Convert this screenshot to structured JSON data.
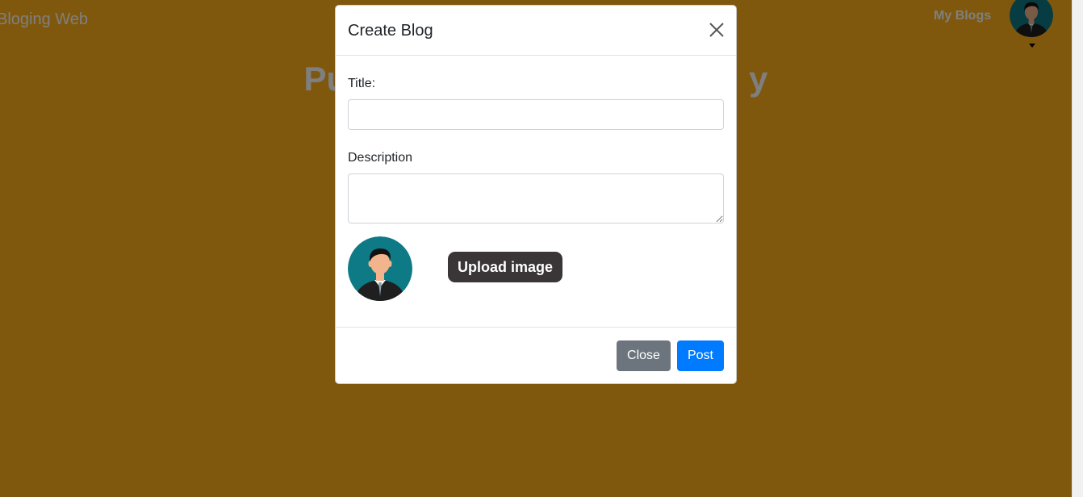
{
  "navbar": {
    "brand": "Bloging Web",
    "my_blogs": "My Blogs",
    "avatar_icon": "user-avatar-icon",
    "caret_icon": "caret-down-icon"
  },
  "hero": {
    "title_left": "Pu",
    "title_right": "y"
  },
  "modal": {
    "title": "Create Blog",
    "close_icon": "close-icon",
    "title_label": "Title:",
    "title_value": "",
    "description_label": "Description",
    "description_value": "",
    "upload_label": "Upload image",
    "image_icon": "user-avatar-icon",
    "close_button": "Close",
    "post_button": "Post"
  },
  "colors": {
    "page_background": "#ffb01a",
    "primary": "#007bff",
    "secondary": "#6c757d",
    "upload_button": "#3a3536",
    "avatar_bg": "#0e7a85"
  }
}
